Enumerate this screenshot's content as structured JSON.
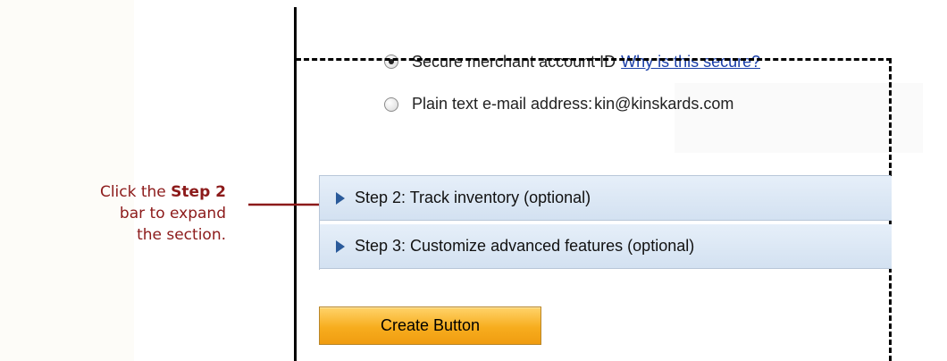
{
  "callout": {
    "pre": "Click the ",
    "bold": "Step 2",
    "line2": "bar to expand",
    "line3": "the section."
  },
  "form": {
    "option_merchant_label": "Secure merchant account ID",
    "option_merchant_link": "Why is this secure?",
    "option_email_label": "Plain text e-mail address:",
    "option_email_value": "kin@kinskards.com",
    "step2_label": "Step 2: Track inventory (optional)",
    "step3_label": "Step 3: Customize advanced features (optional)",
    "create_button_label": "Create Button"
  },
  "colors": {
    "callout_text": "#8c1a1a",
    "link": "#1a3ea8",
    "step_bar": "#dce7f4",
    "button": "#f7ad1e"
  }
}
